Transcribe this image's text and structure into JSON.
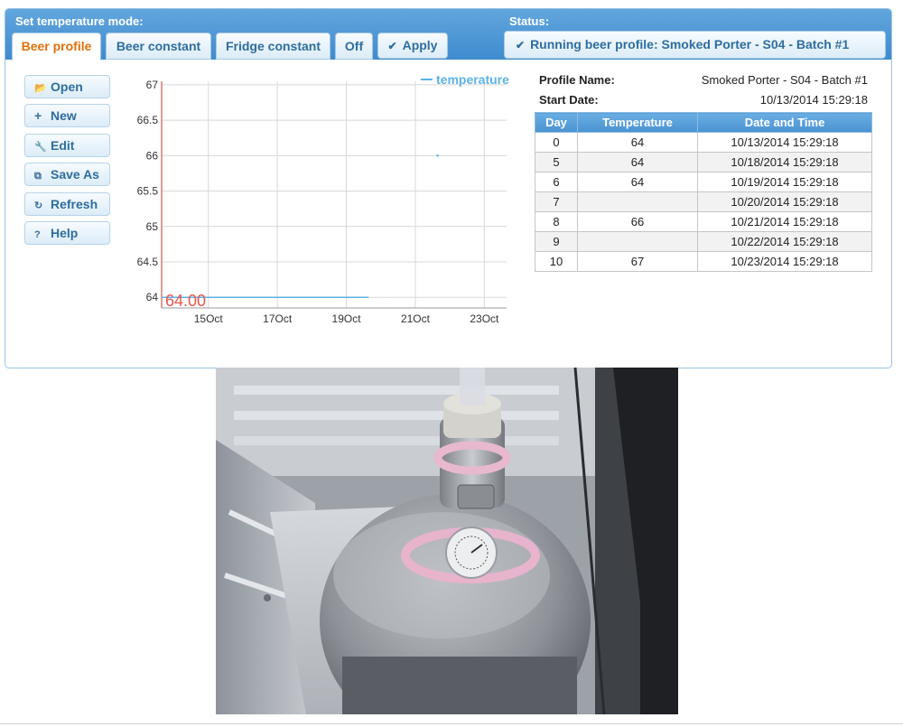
{
  "header": {
    "mode_label": "Set temperature mode:",
    "status_label": "Status:"
  },
  "tabs": [
    {
      "label": "Beer profile",
      "active": true
    },
    {
      "label": "Beer constant",
      "active": false
    },
    {
      "label": "Fridge constant",
      "active": false
    },
    {
      "label": "Off",
      "active": false
    }
  ],
  "apply_label": "Apply",
  "status_text": "Running beer profile: Smoked Porter - S04 - Batch #1",
  "sidebar": {
    "buttons": [
      {
        "label": "Open",
        "icon": "folder-open-icon"
      },
      {
        "label": "New",
        "icon": "plus-icon"
      },
      {
        "label": "Edit",
        "icon": "wrench-icon"
      },
      {
        "label": "Save As",
        "icon": "copy-icon"
      },
      {
        "label": "Refresh",
        "icon": "refresh-icon"
      },
      {
        "label": "Help",
        "icon": "help-icon"
      }
    ]
  },
  "chart_data": {
    "type": "line",
    "legend": [
      "temperature"
    ],
    "legend_position": "top-right",
    "x_ticks": [
      "15Oct",
      "17Oct",
      "19Oct",
      "21Oct",
      "23Oct"
    ],
    "y_ticks": [
      64,
      64.5,
      65,
      65.5,
      66,
      66.5,
      67
    ],
    "xlim": [
      "2014-10-13T15:29",
      "2014-10-23T15:29"
    ],
    "ylim": [
      63.85,
      67.05
    ],
    "grid": true,
    "current_value_label": "64.00",
    "series": [
      {
        "name": "temperature",
        "color": "#5cb3e8",
        "points": [
          {
            "x": "2014-10-13T15:29",
            "y": 64
          },
          {
            "x": "2014-10-19T15:29",
            "y": 64
          },
          {
            "x": "2014-10-21T15:29",
            "y": 66
          },
          {
            "x": "2014-10-21T15:29",
            "y": 66
          }
        ]
      }
    ]
  },
  "profile": {
    "name_label": "Profile Name:",
    "name_value": "Smoked Porter - S04 - Batch #1",
    "start_label": "Start Date:",
    "start_value": "10/13/2014 15:29:18",
    "columns": [
      "Day",
      "Temperature",
      "Date and Time"
    ],
    "rows": [
      {
        "day": "0",
        "temp": "64",
        "date": "10/13/2014 15:29:18"
      },
      {
        "day": "5",
        "temp": "64",
        "date": "10/18/2014 15:29:18"
      },
      {
        "day": "6",
        "temp": "64",
        "date": "10/19/2014 15:29:18"
      },
      {
        "day": "7",
        "temp": "",
        "date": "10/20/2014 15:29:18"
      },
      {
        "day": "8",
        "temp": "66",
        "date": "10/21/2014 15:29:18"
      },
      {
        "day": "9",
        "temp": "",
        "date": "10/22/2014 15:29:18"
      },
      {
        "day": "10",
        "temp": "67",
        "date": "10/23/2014 15:29:18"
      }
    ]
  },
  "colors": {
    "accent_blue": "#4a93d1",
    "active_tab_text": "#e17009",
    "current_value_red": "#e8554e",
    "series_line": "#5cb3e8"
  }
}
